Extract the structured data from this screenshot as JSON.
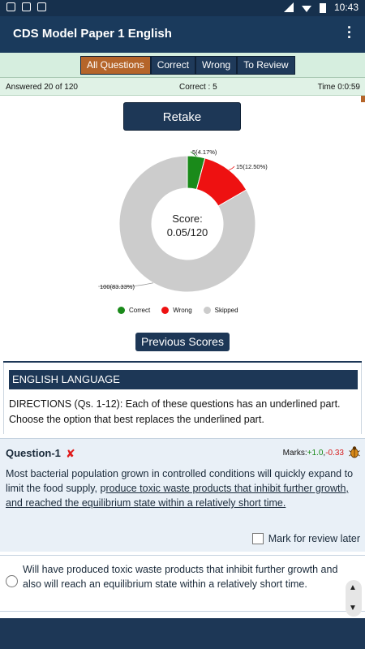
{
  "status_bar": {
    "time": "10:43"
  },
  "app_bar": {
    "title": "CDS Model Paper 1 English"
  },
  "filter_tabs": [
    {
      "label": "All Questions",
      "active": true
    },
    {
      "label": "Correct",
      "active": false
    },
    {
      "label": "Wrong",
      "active": false
    },
    {
      "label": "To Review",
      "active": false
    }
  ],
  "info": {
    "answered": "Answered 20 of 120",
    "correct": "Correct : 5",
    "time": "Time 0:0:59"
  },
  "retake_label": "Retake",
  "score": {
    "title": "Score:",
    "value": "0.05/120"
  },
  "chart_data": {
    "type": "pie",
    "categories": [
      "Correct",
      "Wrong",
      "Skipped"
    ],
    "values": [
      5,
      15,
      100
    ],
    "labels": [
      "5(4.17%)",
      "15(12.50%)",
      "100(83.33%)"
    ],
    "colors": [
      "#1a8a1a",
      "#ee1111",
      "#cccccc"
    ],
    "legend_position": "bottom",
    "donut": true
  },
  "previous_scores_label": "Previous Scores",
  "section": {
    "heading": "ENGLISH LANGUAGE",
    "directions": "DIRECTIONS (Qs. 1-12): Each of these questions has an underlined part. Choose the option that best replaces the underlined part."
  },
  "question": {
    "title": "Question-1",
    "wrong_mark": "✘",
    "marks_label": "Marks:",
    "marks_positive": "+1.0",
    "marks_sep": ",",
    "marks_negative": "-0.33",
    "text_plain": "Most bacterial population grown in controlled conditions will quickly expand to limit the food supply, p",
    "text_underlined": "roduce toxic waste products that inhibit further growth, and reached the equilibrium state within a relatively short time.",
    "mark_review_label": "Mark for review later"
  },
  "option_1": {
    "text": "Will have produced toxic waste products that inhibit further growth and also will reach an equilibrium state within a relatively short time."
  }
}
